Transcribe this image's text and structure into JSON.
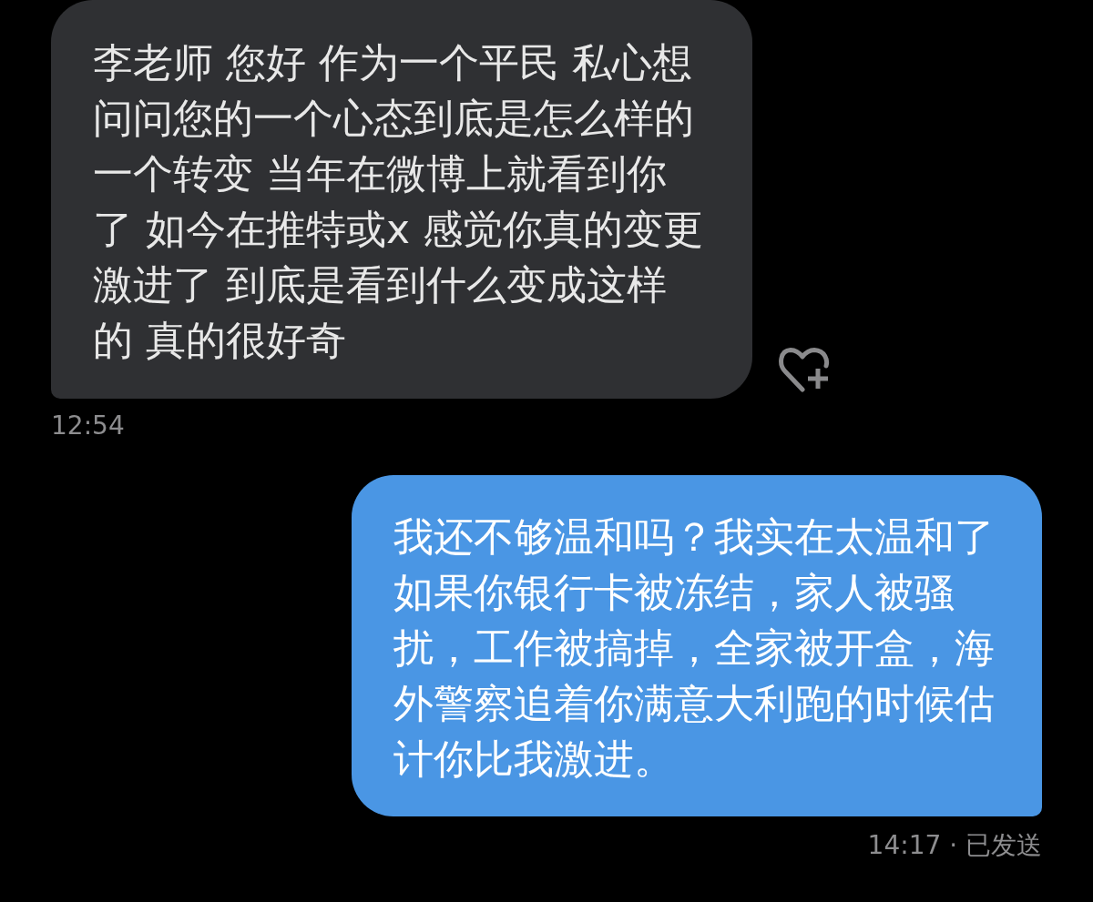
{
  "messages": [
    {
      "kind": "received",
      "text": "李老师 您好 作为一个平民 私心想问问您的一个心态到底是怎么样的一个转变 当年在微博上就看到你了 如今在推特或x 感觉你真的变更激进了 到底是看到什么变成这样的 真的很好奇",
      "meta": "12:54"
    },
    {
      "kind": "sent",
      "text": "我还不够温和吗？我实在太温和了如果你银行卡被冻结，家人被骚扰，工作被搞掉，全家被开盒，海外警察追着你满意大利跑的时候估计你比我激进。",
      "meta": "14:17 · 已发送"
    }
  ]
}
